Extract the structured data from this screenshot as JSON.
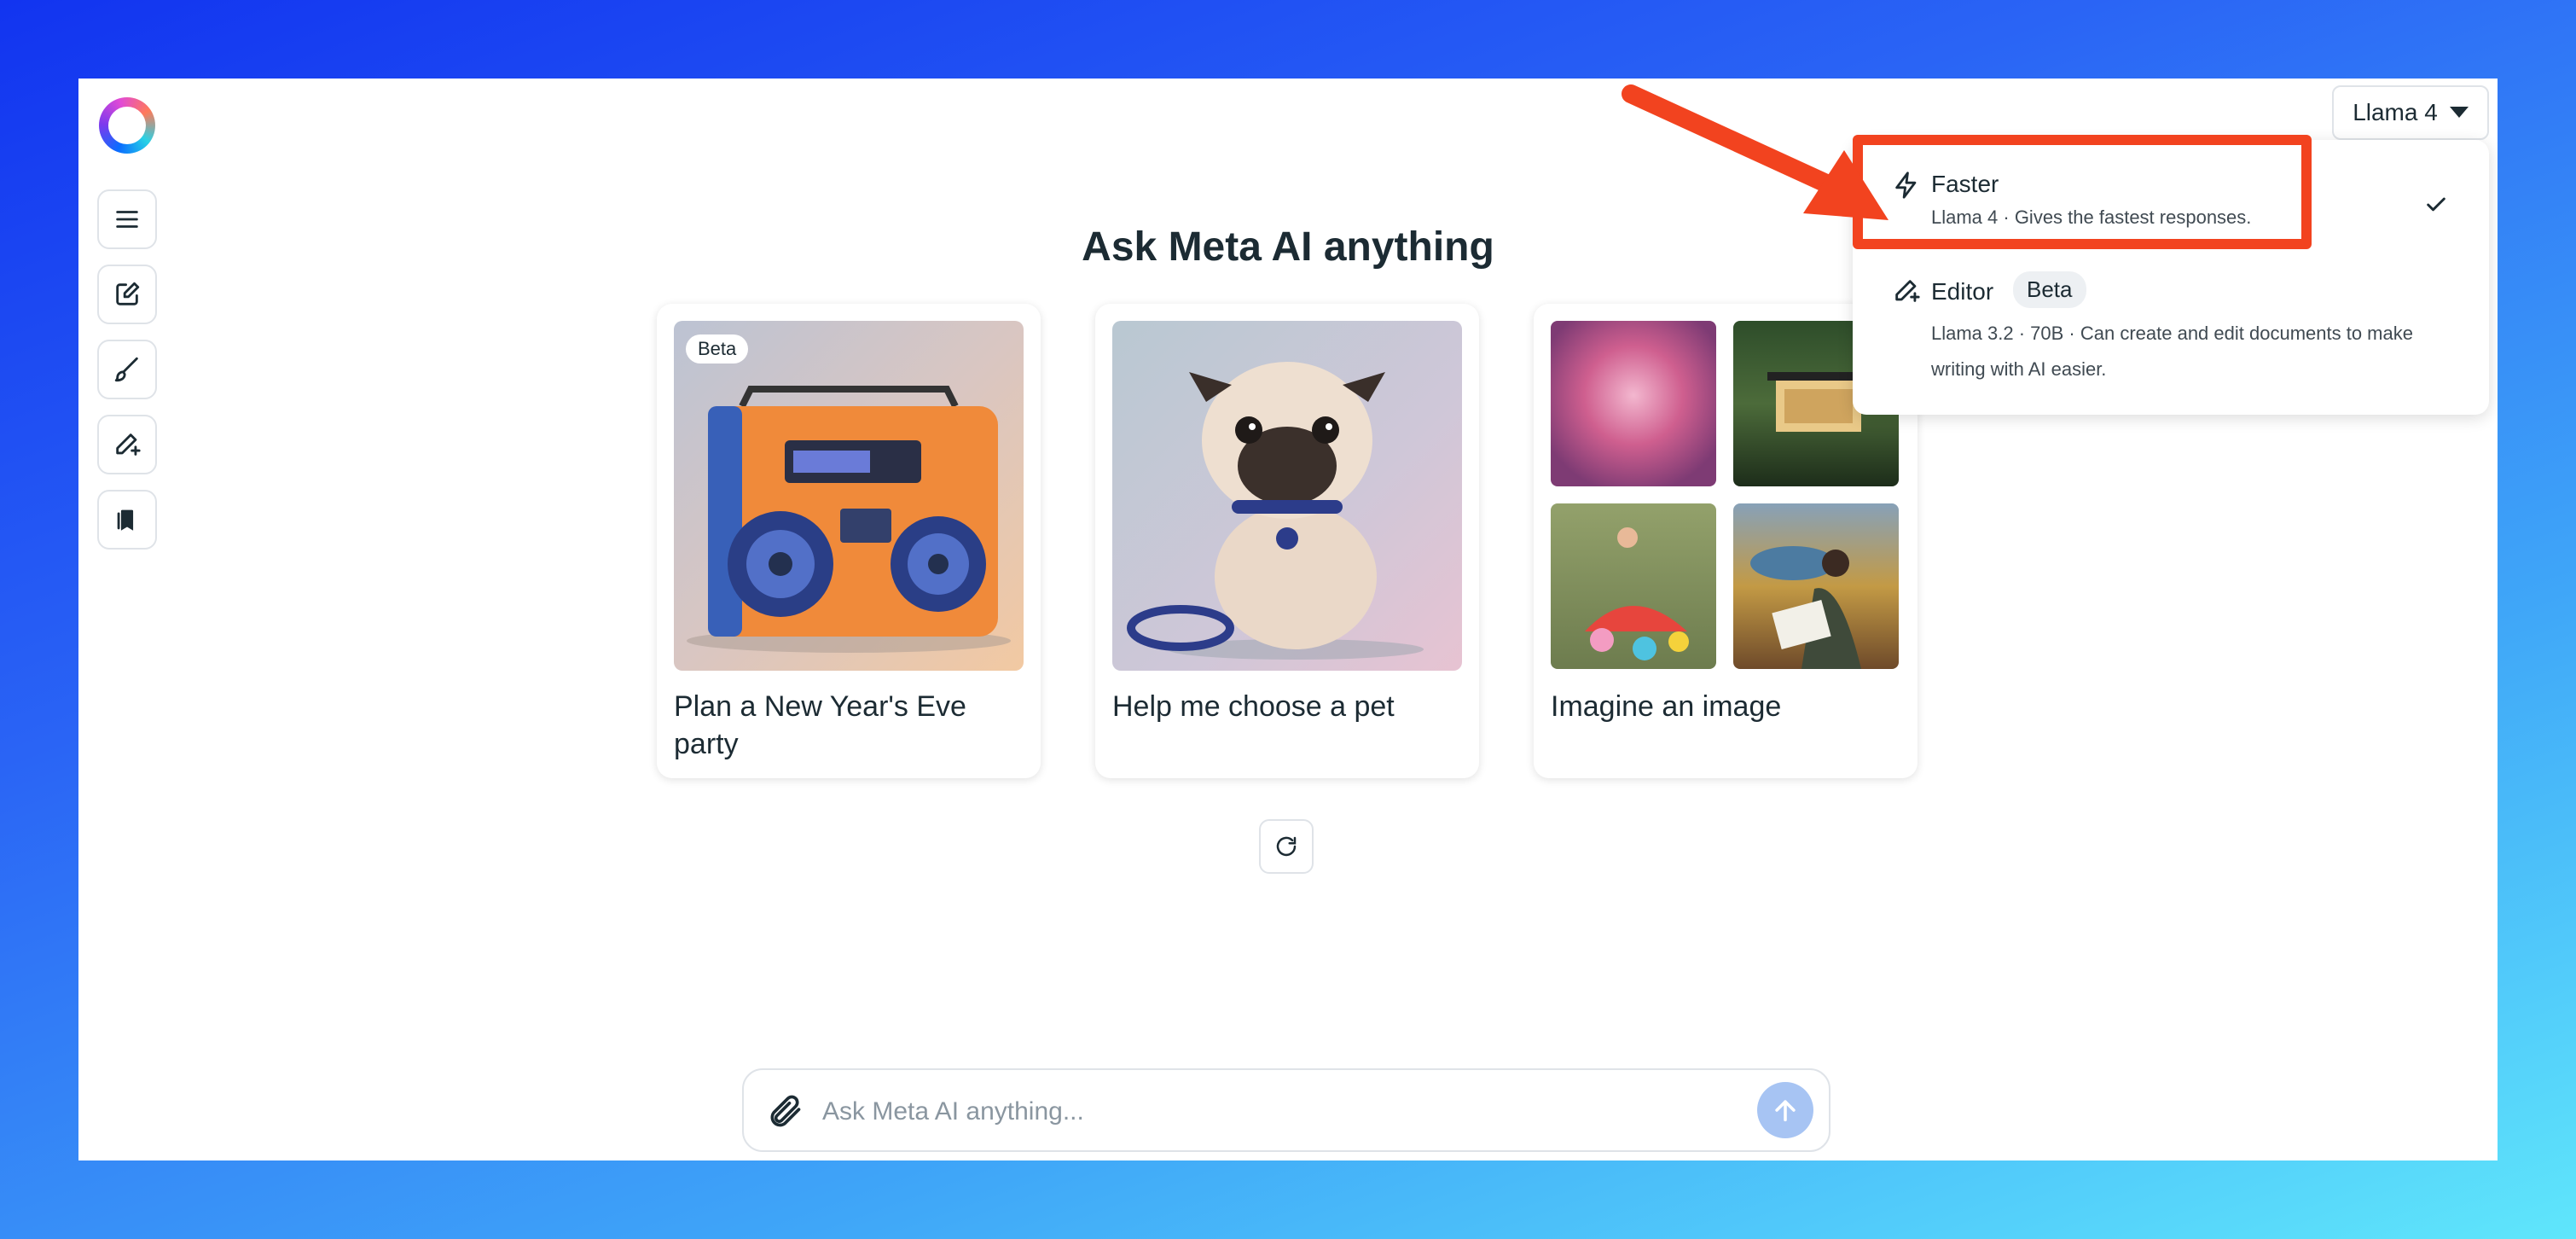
{
  "app": {
    "heading": "Ask Meta AI anything",
    "model_selector": {
      "label": "Llama 4"
    }
  },
  "sidebar": {
    "items": [
      {
        "name": "menu",
        "icon": "hamburger-menu-icon"
      },
      {
        "name": "new-chat",
        "icon": "compose-icon"
      },
      {
        "name": "imagine",
        "icon": "brush-icon"
      },
      {
        "name": "editor",
        "icon": "pencil-sparkle-icon"
      },
      {
        "name": "library",
        "icon": "books-icon"
      }
    ]
  },
  "cards": [
    {
      "title": "Plan a New Year's Eve party",
      "badge": "Beta",
      "image": "boombox"
    },
    {
      "title": "Help me choose a pet",
      "image": "pug"
    },
    {
      "title": "Imagine an image",
      "image": "image-grid"
    }
  ],
  "dropdown": {
    "items": [
      {
        "title": "Faster",
        "description": "Llama 4 · Gives the fastest responses.",
        "icon": "lightning-icon",
        "selected": true
      },
      {
        "title": "Editor",
        "badge": "Beta",
        "description": "Llama 3.2 · 70B · Can create and edit documents to make writing with AI easier.",
        "icon": "pencil-sparkle-icon",
        "selected": false
      }
    ]
  },
  "chat": {
    "placeholder": "Ask Meta AI anything..."
  },
  "colors": {
    "highlight": "#f2431f",
    "send_button": "#a7c4f3",
    "background_start": "#1234f0",
    "background_end": "#5fe6fb"
  }
}
